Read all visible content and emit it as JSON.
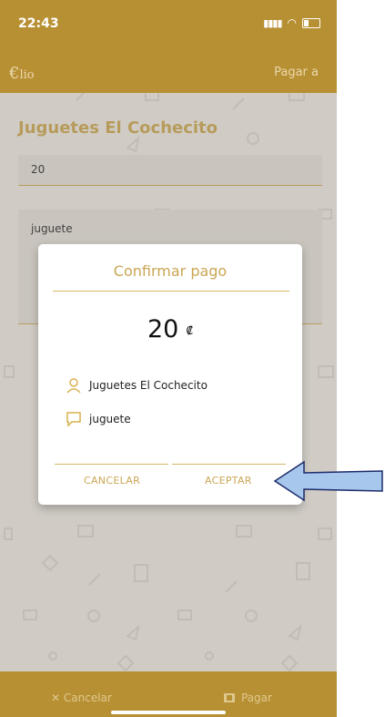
{
  "status_bar": {
    "time": "22:43"
  },
  "app_bar": {
    "logo_main": "€",
    "logo_suffix": "lio",
    "action": "Pagar a"
  },
  "form": {
    "merchant": "Juguetes El Cochecito",
    "amount": "20",
    "note": "juguete"
  },
  "dialog": {
    "title": "Confirmar pago",
    "amount": "20",
    "currency": "₡",
    "recipient": "Juguetes El Cochecito",
    "message": "juguete",
    "cancel_label": "CANCELAR",
    "accept_label": "ACEPTAR"
  },
  "bottom_bar": {
    "cancel_label": "Cancelar",
    "pay_label": "Pagar"
  },
  "colors": {
    "accent": "#b89034",
    "accent_text": "#caa654",
    "arrow": "#a7c7ec"
  },
  "icons": [
    "signal-icon",
    "wifi-icon",
    "battery-icon",
    "person-icon",
    "chat-bubble-icon",
    "close-icon",
    "pay-icon"
  ]
}
